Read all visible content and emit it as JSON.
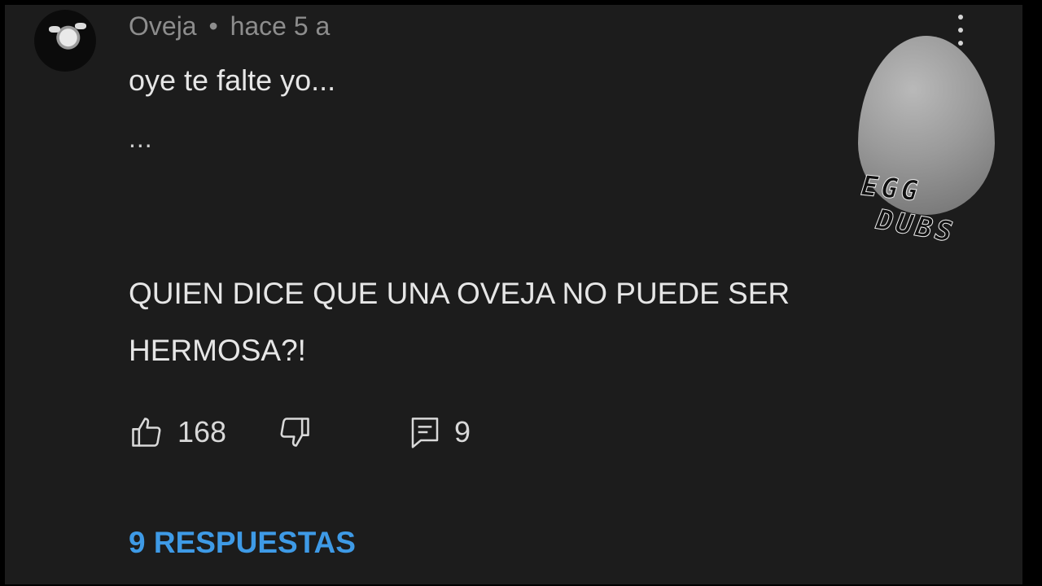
{
  "comment": {
    "author": "Oveja",
    "separator": "•",
    "time": "hace 5 a",
    "lines": [
      "oye te falte yo...",
      "...",
      "QUIEN DICE QUE UNA OVEJA NO PUEDE SER",
      "HERMOSA?!"
    ],
    "likes": "168",
    "reply_count": "9",
    "replies_link": "9 RESPUESTAS"
  },
  "watermark": {
    "line1": "EGG",
    "line2": "DUBS"
  },
  "icons": {
    "like": "thumbs-up-icon",
    "dislike": "thumbs-down-icon",
    "reply": "comment-icon",
    "menu": "more-vertical-icon"
  },
  "colors": {
    "background": "#1c1c1c",
    "text": "#e6e6e6",
    "meta": "#8d8d8d",
    "link": "#3e9ae6"
  }
}
